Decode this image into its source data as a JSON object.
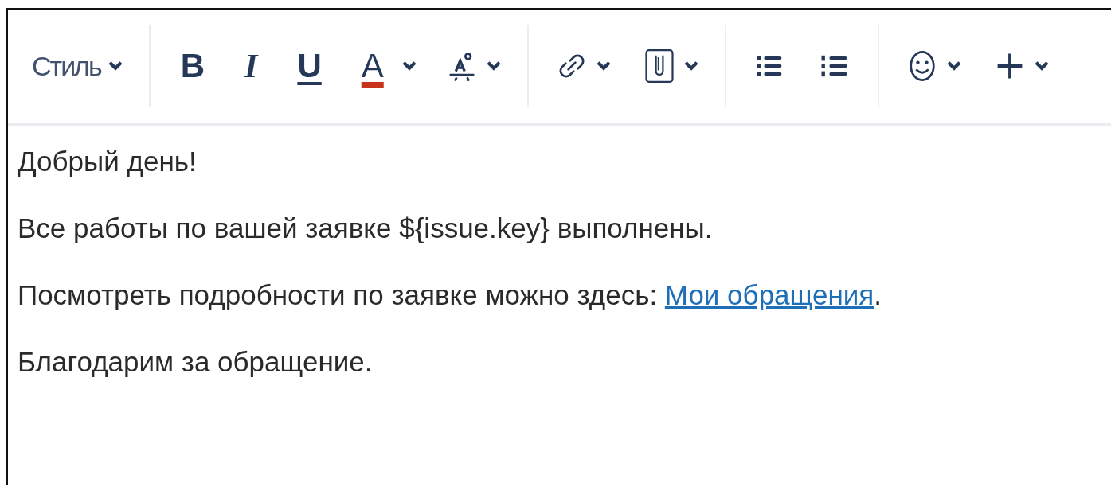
{
  "toolbar": {
    "groups": [
      [
        {
          "kind": "style-menu",
          "label": "Стиль",
          "dropdown": true
        }
      ],
      [
        {
          "kind": "bold",
          "label": "B",
          "dropdown": false
        },
        {
          "kind": "italic",
          "label": "I",
          "dropdown": false
        },
        {
          "kind": "underline",
          "label": "U",
          "dropdown": false
        },
        {
          "kind": "text-color",
          "label": "A",
          "dropdown": true
        },
        {
          "kind": "text-effects",
          "dropdown": true
        }
      ],
      [
        {
          "kind": "link",
          "dropdown": true
        },
        {
          "kind": "attachment",
          "dropdown": true
        }
      ],
      [
        {
          "kind": "bullet-list",
          "dropdown": false
        },
        {
          "kind": "numbered-list",
          "dropdown": false
        }
      ],
      [
        {
          "kind": "emoji",
          "dropdown": true
        },
        {
          "kind": "insert",
          "dropdown": true
        }
      ]
    ]
  },
  "body": {
    "paragraphs": [
      {
        "text": "Добрый день!"
      },
      {
        "text": "Все работы по вашей заявке ${issue.key} выполнены."
      },
      {
        "text": "Посмотреть подробности по заявке можно здесь: ",
        "link": "Мои обращения",
        "after": "."
      },
      {
        "text": "Благодарим за обращение."
      }
    ]
  }
}
